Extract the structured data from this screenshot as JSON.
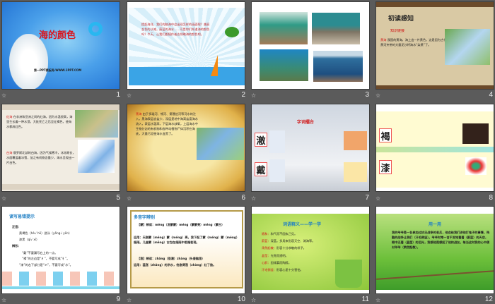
{
  "slides": [
    {
      "number": "1",
      "title": "海的颜色",
      "footer": "第一PPT模板网-WWW.1PPT.COM"
    },
    {
      "number": "2",
      "text": "提起海洋，我们的脑海中会出现怎样的画面呢？美丽金色的沙滩，蔚蓝的海水……可是你们知道海的颜色吗？今天，让我们跟随作者去领略海的颜色吧。"
    },
    {
      "number": "3"
    },
    {
      "number": "4",
      "title": "初读感知",
      "subtitle": "知识链接",
      "label": "黄海",
      "text": "我国的黄海，海上出一片黄色，这是因为古代黄河夹带的大量泥沙将海水“染黄”了。"
    },
    {
      "number": "5",
      "label1": "红海",
      "text1": "在非洲和亚洲之间的红海，因为水温很高，海里生长着一种水藻，大批死亡之后呈红褐色，使海水都成红色。",
      "label2": "白海",
      "text2": "俄罗斯北部的白海，因为气候寒冷，冰冻期长，水面覆盖着冰雪，加之有机物含量少，海水呈现出一片白色。"
    },
    {
      "number": "6",
      "label": "黑海",
      "text": "由于多瑙河、顿河、第聂伯河等河水的注入，黑海表层含盐少，深层是地中海高盐度海水流入，表层水温高，下层海水缺氧，上层海水中生物分泌的有机物和各种动植物尸体沉积在海底，大量污泥使海水变黑了。"
    },
    {
      "number": "7",
      "title": "字词擂台",
      "char1": "澈",
      "char2": "戴"
    },
    {
      "number": "8",
      "char1": "褐",
      "char2": "漆"
    },
    {
      "number": "9",
      "title": "读写易错提示",
      "lines": [
        "正音：",
        "黄褐色（hè√ hē）游泳（yǒng√ yǒn）",
        "漆黑（qī√ xī）",
        "辨形：",
        "“戴”不要漏写右上的一点。",
        "“褐”的左边是“衤”，不要写成“礻”。",
        "“漆”的右下部分是“氺”，不要写成“水”。"
      ]
    },
    {
      "number": "10",
      "title": "多音字辨别",
      "lines": [
        "【蒙】辨读：mēng（发蒙蒙）méng（蒙蒙亮）měng（蒙古）",
        "运用：天刚蒙（méng）蒙（méng）亮，我下起了蒙（méng）蒙（méng）细雨。几座蒙（měng）古包在细雨中若隐若现。",
        "【涨】辨读：zhǎng（涨潮）zhàng（头昏脑涨）",
        "运用：猛涨（zhǎng）的洪水，他急得涨（zhàng）红了脸。"
      ]
    },
    {
      "number": "11",
      "title": "词语释义——学一学",
      "items": [
        [
          "随和：",
          "和气而不固执己见。"
        ],
        [
          "蔚蓝：",
          "深蓝。多用来形容天空、湖海等。"
        ],
        [
          "肃然起敬：",
          "形容十分恭敬的样子。"
        ],
        [
          "晶莹：",
          "光亮而透明。"
        ],
        [
          "心醉：",
          "因倾慕而陶醉。"
        ],
        [
          "汗毛倒竖：",
          "形容心里十分害怕。"
        ]
      ]
    },
    {
      "number": "12",
      "title": "用一用",
      "text": "我的爷爷是一名参加过抗日战争的老兵，他会给我们讲他打鬼子的事情，残酷的战争让我们（汗毛倒竖）。爷爷时常一言不发地看着（蔚蓝）的天空，眼中泛着（晶莹）的泪光，我想他是想起了他的战友。每当这时我的心中便对爷爷（肃然起敬）。"
    }
  ],
  "star_icon": "☆"
}
